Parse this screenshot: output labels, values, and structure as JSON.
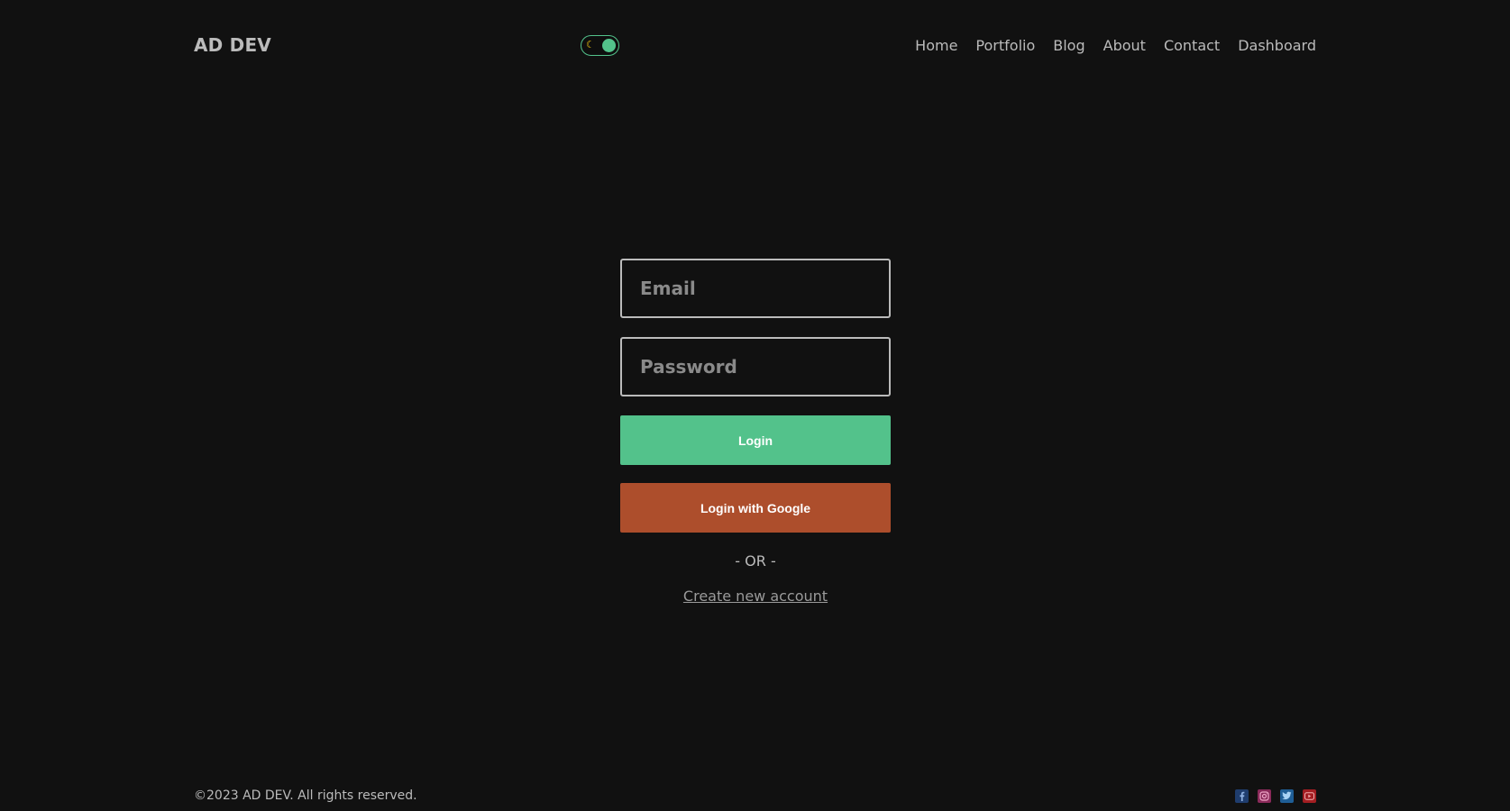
{
  "header": {
    "logo": "AD DEV",
    "theme_toggle": {
      "icon": "moon-icon",
      "accent": "#53c28b"
    },
    "nav": [
      {
        "label": "Home"
      },
      {
        "label": "Portfolio"
      },
      {
        "label": "Blog"
      },
      {
        "label": "About"
      },
      {
        "label": "Contact"
      },
      {
        "label": "Dashboard"
      }
    ]
  },
  "login_form": {
    "email_placeholder": "Email",
    "password_placeholder": "Password",
    "login_label": "Login",
    "google_label": "Login with Google",
    "separator": "- OR -",
    "create_account_label": "Create new account"
  },
  "footer": {
    "copyright": "©2023 AD DEV. All rights reserved.",
    "socials": [
      {
        "icon": "facebook-icon",
        "color": "#1f3d6e"
      },
      {
        "icon": "instagram-icon",
        "color": "#8a2a5a"
      },
      {
        "icon": "twitter-icon",
        "color": "#1f5e96"
      },
      {
        "icon": "youtube-icon",
        "color": "#a31e22"
      }
    ]
  },
  "colors": {
    "background": "#111111",
    "text": "#bbbbbb",
    "login_button": "#53c28b",
    "google_button": "#ad4e2c"
  }
}
